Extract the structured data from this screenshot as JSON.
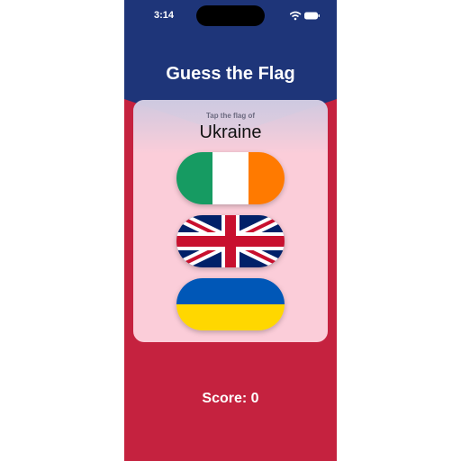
{
  "status_bar": {
    "time": "3:14"
  },
  "app": {
    "title": "Guess the Flag"
  },
  "question": {
    "prompt": "Tap the flag of",
    "country": "Ukraine"
  },
  "flags": [
    {
      "country": "Ireland",
      "icon": "ireland-flag-icon"
    },
    {
      "country": "United Kingdom",
      "icon": "union-jack-flag-icon"
    },
    {
      "country": "Ukraine",
      "icon": "ukraine-flag-icon"
    }
  ],
  "score": {
    "text": "Score: 0",
    "value": 0
  },
  "colors": {
    "header_blue": "#1e3579",
    "background_red": "#c5223f",
    "card": "#ffdce6"
  }
}
